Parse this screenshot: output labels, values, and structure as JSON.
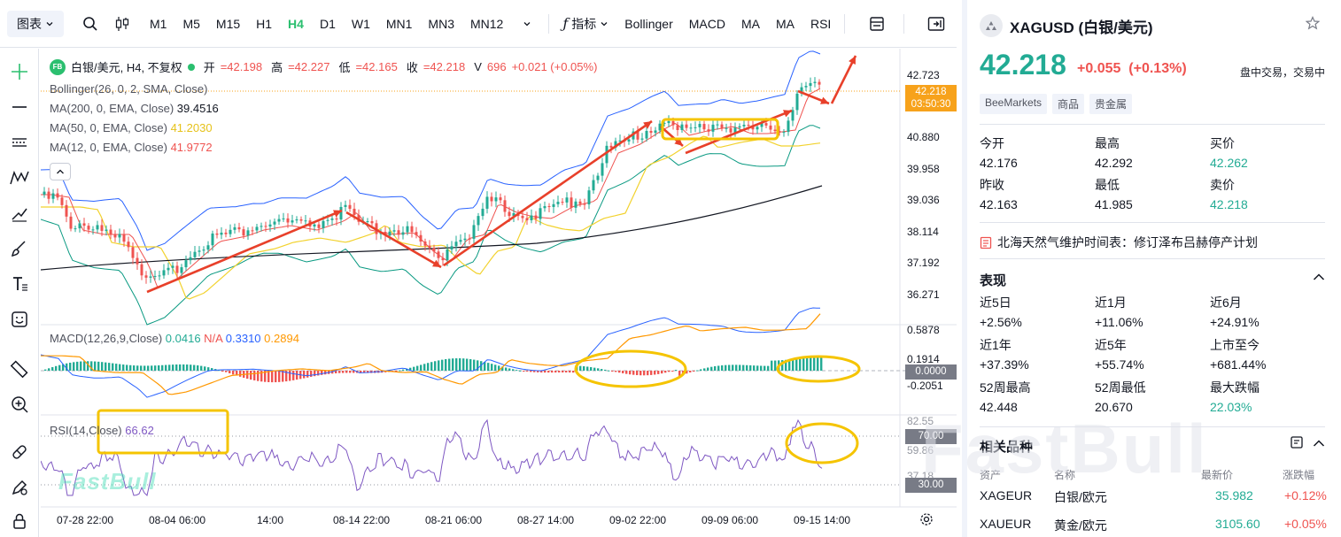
{
  "toolbar": {
    "chart_type_label": "图表",
    "timeframes": [
      "M1",
      "M5",
      "M15",
      "H1",
      "H4",
      "D1",
      "W1",
      "MN1",
      "MN3",
      "MN12"
    ],
    "active_timeframe": "H4",
    "indicators_label": "指标",
    "indicator_shortcuts": [
      "Bollinger",
      "MACD",
      "MA",
      "MA",
      "RSI"
    ]
  },
  "legend": {
    "fb_badge": "FB",
    "symbol_desc": "白银/美元, H4, 不复权",
    "open_label": "开",
    "open": "=42.198",
    "high_label": "高",
    "high": "=42.227",
    "low_label": "低",
    "low": "=42.165",
    "close_label": "收",
    "close": "=42.218",
    "volume_label": "V",
    "volume": "696",
    "change": "+0.021 (+0.05%)",
    "bollinger": "Bollinger(26, 0, 2, SMA, Close)",
    "ma200_label": "MA(200, 0, EMA, Close)",
    "ma200": "39.4516",
    "ma50_label": "MA(50, 0, EMA, Close)",
    "ma50": "41.2030",
    "ma12_label": "MA(12, 0, EMA, Close)",
    "ma12": "41.9772",
    "macd_label": "MACD(12,26,9,Close)",
    "macd_1": "0.0416",
    "macd_2": "N/A",
    "macd_3": "0.3310",
    "macd_4": "0.2894",
    "rsi_label": "RSI(14,Close)",
    "rsi": "66.62"
  },
  "price_axis": {
    "main_ticks": [
      "42.723",
      "40.880",
      "39.958",
      "39.036",
      "38.114",
      "37.192",
      "36.271"
    ],
    "current_price": "42.218",
    "countdown": "03:50:30",
    "macd_ticks": [
      "0.5878",
      "0.1914",
      "-0.2051"
    ],
    "macd_current": "0.0000",
    "rsi_ticks": [
      "82.55",
      "59.86",
      "37.18"
    ],
    "rsi_70": "70.00",
    "rsi_30": "30.00"
  },
  "time_axis": [
    "07-28 22:00",
    "08-04 06:00",
    "14:00",
    "08-14 22:00",
    "08-21 06:00",
    "08-27 14:00",
    "09-02 22:00",
    "09-09 06:00",
    "09-15 14:00"
  ],
  "watermark_small": "FastBull",
  "watermark_big": "FastBull",
  "colors": {
    "up": "#22ab94",
    "down": "#ef5350",
    "accent": "#2bbf6f",
    "annotation": "#f5c400",
    "arrow": "#e8402a"
  },
  "panel": {
    "symbol": "XAGUSD (白银/美元)",
    "price": "42.218",
    "change": "+0.055",
    "change_pct": "(+0.13%)",
    "status": "盘中交易，交易中",
    "tags": [
      "BeeMarkets",
      "商品",
      "贵金属"
    ],
    "open_label": "今开",
    "open": "42.176",
    "high_label": "最高",
    "high": "42.292",
    "bid_label": "买价",
    "bid": "42.262",
    "prev_close_label": "昨收",
    "prev_close": "42.163",
    "low_label": "最低",
    "low": "41.985",
    "ask_label": "卖价",
    "ask": "42.218",
    "news": "北海天然气维护时间表：修订泽布吕赫停产计划",
    "performance_title": "表现",
    "perf": [
      {
        "label": "近5日",
        "value": "+2.56%"
      },
      {
        "label": "近1月",
        "value": "+11.06%"
      },
      {
        "label": "近6月",
        "value": "+24.91%"
      },
      {
        "label": "近1年",
        "value": "+37.39%"
      },
      {
        "label": "近5年",
        "value": "+55.74%"
      },
      {
        "label": "上市至今",
        "value": "+681.44%"
      },
      {
        "label": "52周最高",
        "value": "42.448"
      },
      {
        "label": "52周最低",
        "value": "20.670"
      },
      {
        "label": "最大跌幅",
        "value": "22.03%"
      }
    ],
    "related_title": "相关品种",
    "related_headers": [
      "资产",
      "名称",
      "最新价",
      "涨跌幅"
    ],
    "related": [
      {
        "asset": "XAGEUR",
        "name": "白银/欧元",
        "price": "35.982",
        "pct": "+0.12%"
      },
      {
        "asset": "XAUEUR",
        "name": "黄金/欧元",
        "price": "3105.60",
        "pct": "+0.05%"
      }
    ]
  }
}
